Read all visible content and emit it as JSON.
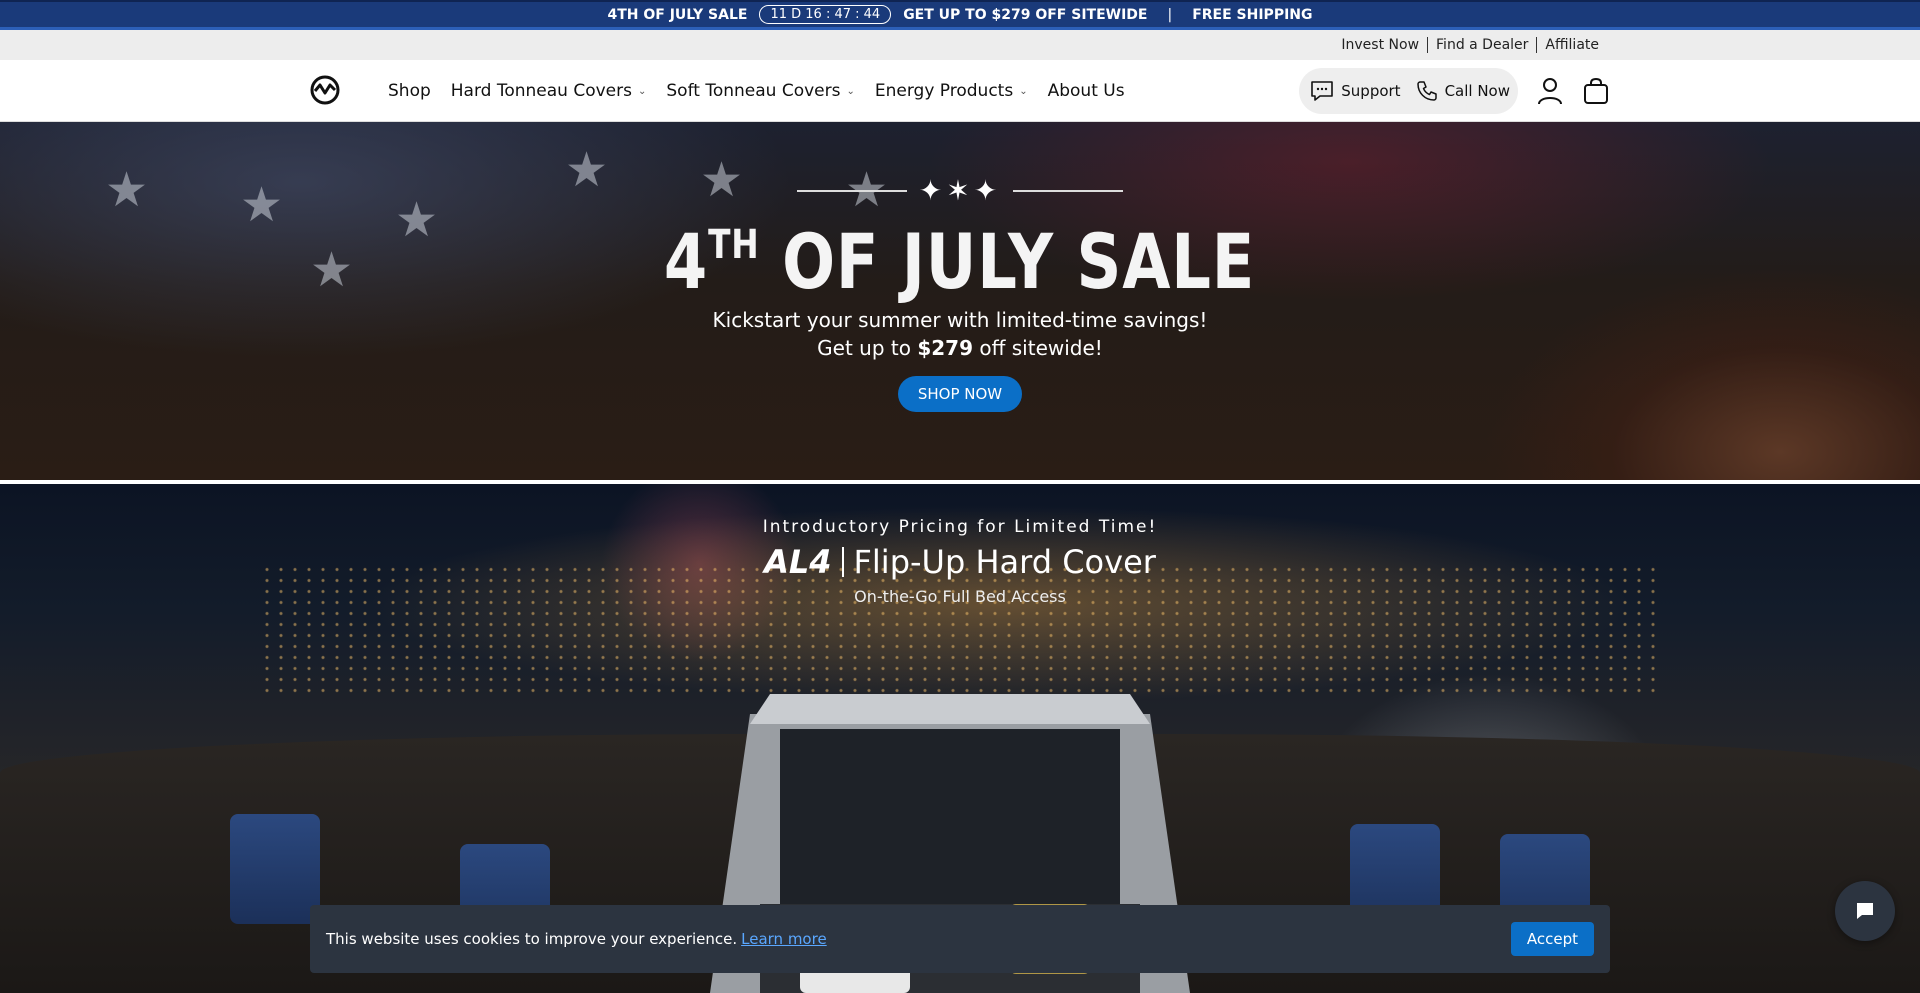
{
  "announcement": {
    "sale_label": "4TH OF JULY SALE",
    "countdown": "11 D  16 : 47 : 44",
    "offer": "GET UP TO $279 OFF SITEWIDE",
    "separator": "|",
    "shipping": "FREE SHIPPING"
  },
  "utility_links": {
    "invest": "Invest Now",
    "dealer": "Find a Dealer",
    "affiliate": "Affiliate"
  },
  "nav": {
    "items": {
      "shop": "Shop",
      "hard": "Hard Tonneau Covers",
      "soft": "Soft Tonneau Covers",
      "energy": "Energy Products",
      "about": "About Us"
    },
    "support": "Support",
    "call": "Call Now"
  },
  "hero1": {
    "title_num": "4",
    "title_sup": "TH",
    "title_rest": " OF JULY SALE",
    "subtitle_line1": "Kickstart your summer with limited-time savings!",
    "subtitle_pre": "Get up to ",
    "subtitle_amount": "$279",
    "subtitle_post": " off sitewide!",
    "cta": "SHOP NOW"
  },
  "hero2": {
    "intro": "Introductory Pricing for Limited Time!",
    "model": "AL4",
    "product": "Flip-Up Hard Cover",
    "tagline": "On-the-Go Full Bed Access"
  },
  "cookie": {
    "message": "This website uses cookies to improve your experience.",
    "link": "Learn more",
    "accept": "Accept"
  },
  "colors": {
    "announce_bg": "#1a3a7a",
    "accent_blue": "#0b6fc7",
    "cookie_bg": "#2c3440"
  },
  "icons": [
    "logo-icon",
    "chat-bubble-icon",
    "phone-icon",
    "user-icon",
    "bag-icon",
    "chevron-down-icon",
    "fireworks-icon",
    "chat-icon"
  ]
}
